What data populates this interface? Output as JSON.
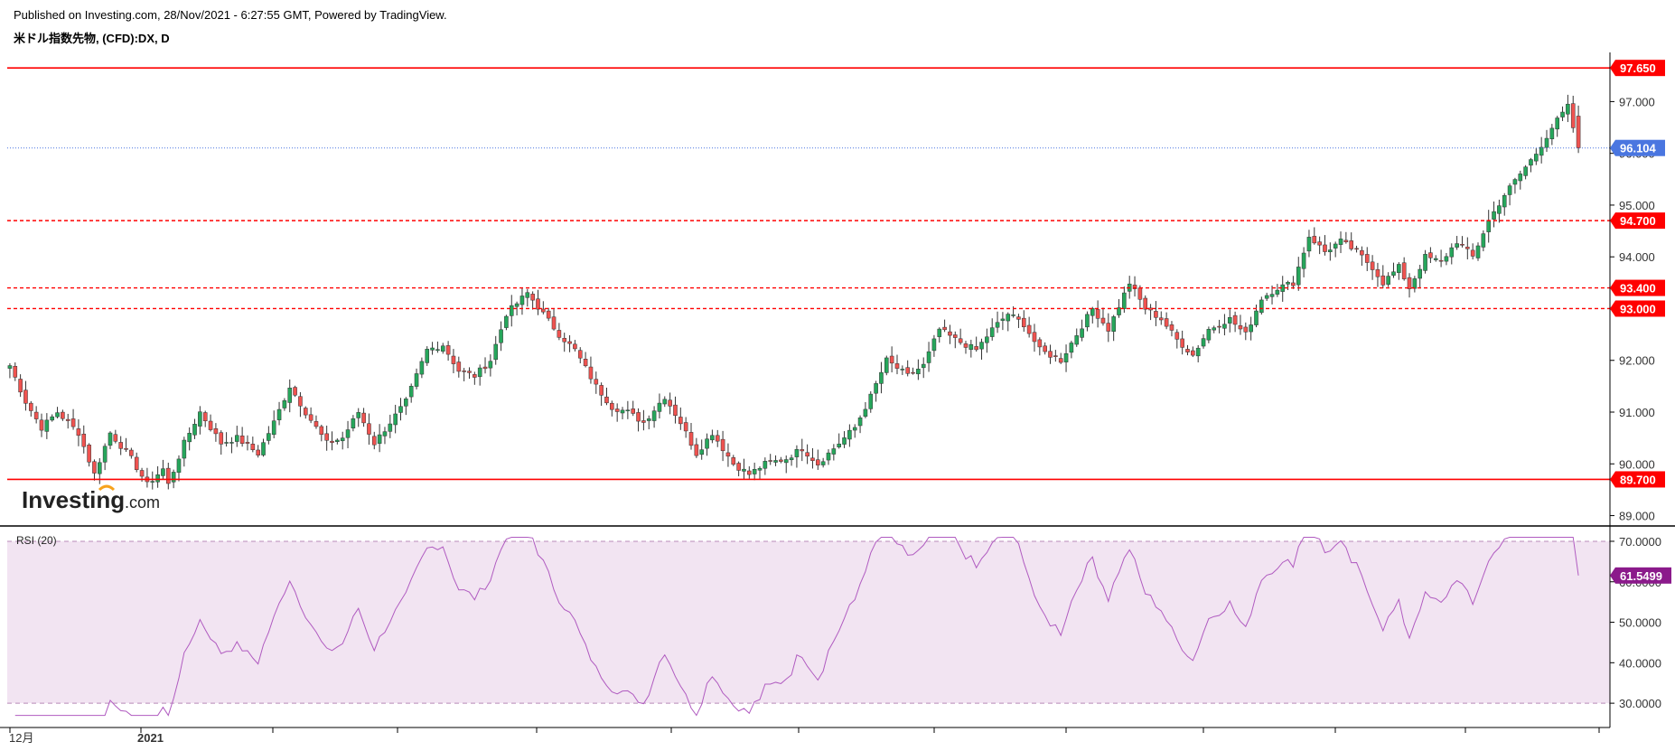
{
  "header": {
    "published": "Published on Investing.com, 28/Nov/2021 - 6:27:55 GMT, Powered by TradingView.",
    "symbol": "米ドル指数先物, (CFD):DX, D"
  },
  "watermark": {
    "brand": "Investing",
    "suffix": ".com"
  },
  "chart_data": [
    {
      "type": "candlestick",
      "instrument": "米ドル指数先物, (CFD):DX, D",
      "ylim": [
        88.8,
        97.95
      ],
      "y_ticks": [
        "89.000",
        "90.000",
        "91.000",
        "92.000",
        "93.000",
        "94.000",
        "95.000",
        "96.000",
        "97.000"
      ],
      "x_tick_labels": [
        "12月",
        "2021"
      ],
      "last_price": {
        "value": 96.104,
        "label": "96.104",
        "color": "#4a76e0"
      },
      "levels": [
        {
          "value": 97.65,
          "label": "97.650",
          "style": "solid",
          "color": "#ff0000"
        },
        {
          "value": 94.7,
          "label": "94.700",
          "style": "dashed",
          "color": "#ff0000"
        },
        {
          "value": 93.4,
          "label": "93.400",
          "style": "dashed",
          "color": "#ff0000"
        },
        {
          "value": 93.0,
          "label": "93.000",
          "style": "dashed",
          "color": "#ff0000"
        },
        {
          "value": 89.7,
          "label": "89.700",
          "style": "solid",
          "color": "#ff0000"
        }
      ],
      "up_color": "#26a65b",
      "down_color": "#ef5350",
      "close_path": [
        [
          0,
          91.9
        ],
        [
          3,
          91.2
        ],
        [
          6,
          90.7
        ],
        [
          9,
          91.0
        ],
        [
          13,
          90.6
        ],
        [
          16,
          89.8
        ],
        [
          19,
          90.6
        ],
        [
          23,
          90.1
        ],
        [
          26,
          89.6
        ],
        [
          29,
          89.9
        ],
        [
          30,
          89.6
        ],
        [
          33,
          90.4
        ],
        [
          36,
          91.0
        ],
        [
          40,
          90.4
        ],
        [
          43,
          90.5
        ],
        [
          47,
          90.2
        ],
        [
          50,
          90.8
        ],
        [
          53,
          91.5
        ],
        [
          56,
          91.0
        ],
        [
          60,
          90.4
        ],
        [
          63,
          90.5
        ],
        [
          66,
          91.0
        ],
        [
          69,
          90.4
        ],
        [
          72,
          90.8
        ],
        [
          75,
          91.2
        ],
        [
          79,
          92.2
        ],
        [
          82,
          92.3
        ],
        [
          85,
          91.8
        ],
        [
          88,
          91.7
        ],
        [
          91,
          92.0
        ],
        [
          94,
          92.9
        ],
        [
          98,
          93.3
        ],
        [
          101,
          92.9
        ],
        [
          104,
          92.5
        ],
        [
          107,
          92.2
        ],
        [
          111,
          91.5
        ],
        [
          114,
          91.1
        ],
        [
          117,
          91.0
        ],
        [
          120,
          90.8
        ],
        [
          124,
          91.3
        ],
        [
          127,
          90.8
        ],
        [
          130,
          90.2
        ],
        [
          133,
          90.6
        ],
        [
          137,
          90.0
        ],
        [
          140,
          89.8
        ],
        [
          143,
          90.0
        ],
        [
          147,
          90.1
        ],
        [
          150,
          90.3
        ],
        [
          153,
          90.0
        ],
        [
          157,
          90.4
        ],
        [
          160,
          90.7
        ],
        [
          163,
          91.3
        ],
        [
          166,
          92.0
        ],
        [
          170,
          91.7
        ],
        [
          173,
          91.9
        ],
        [
          176,
          92.6
        ],
        [
          179,
          92.4
        ],
        [
          183,
          92.2
        ],
        [
          186,
          92.6
        ],
        [
          189,
          92.9
        ],
        [
          192,
          92.7
        ],
        [
          195,
          92.2
        ],
        [
          199,
          92.0
        ],
        [
          202,
          92.5
        ],
        [
          205,
          93.0
        ],
        [
          208,
          92.6
        ],
        [
          212,
          93.5
        ],
        [
          215,
          93.0
        ],
        [
          218,
          92.8
        ],
        [
          221,
          92.4
        ],
        [
          224,
          92.1
        ],
        [
          227,
          92.6
        ],
        [
          231,
          92.8
        ],
        [
          234,
          92.5
        ],
        [
          237,
          93.2
        ],
        [
          240,
          93.4
        ],
        [
          243,
          93.5
        ],
        [
          246,
          94.4
        ],
        [
          249,
          94.1
        ],
        [
          252,
          94.3
        ],
        [
          255,
          94.1
        ],
        [
          258,
          93.8
        ],
        [
          260,
          93.5
        ],
        [
          263,
          93.8
        ],
        [
          265,
          93.4
        ],
        [
          268,
          94.0
        ],
        [
          271,
          93.9
        ],
        [
          274,
          94.3
        ],
        [
          277,
          94.0
        ],
        [
          280,
          94.7
        ],
        [
          283,
          95.2
        ],
        [
          286,
          95.6
        ],
        [
          289,
          96.0
        ],
        [
          292,
          96.5
        ],
        [
          295,
          96.9
        ],
        [
          297,
          96.1
        ]
      ],
      "rsi": {
        "title": "RSI (20)",
        "period": 20,
        "ylim": [
          24,
          72
        ],
        "y_ticks": [
          "30.0000",
          "40.0000",
          "50.0000",
          "60.0000",
          "70.0000"
        ],
        "band": [
          30,
          70
        ],
        "last_value": 61.5499,
        "last_label": "61.5499",
        "line_color": "#b05bc0",
        "badge_color": "#8b1a8b",
        "band_fill": "#f2e4f2"
      }
    }
  ]
}
